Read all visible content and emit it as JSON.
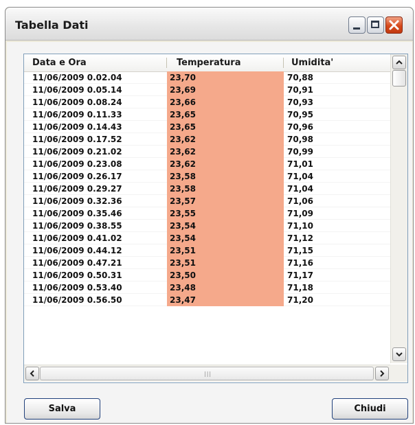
{
  "window": {
    "title": "Tabella Dati"
  },
  "table": {
    "columns": [
      "Data e Ora",
      "Temperatura",
      "Umidita'"
    ],
    "rows": [
      [
        "11/06/2009 0.02.04",
        "23,70",
        "70,88"
      ],
      [
        "11/06/2009 0.05.14",
        "23,69",
        "70,91"
      ],
      [
        "11/06/2009 0.08.24",
        "23,66",
        "70,93"
      ],
      [
        "11/06/2009 0.11.33",
        "23,65",
        "70,95"
      ],
      [
        "11/06/2009 0.14.43",
        "23,65",
        "70,96"
      ],
      [
        "11/06/2009 0.17.52",
        "23,62",
        "70,98"
      ],
      [
        "11/06/2009 0.21.02",
        "23,62",
        "70,99"
      ],
      [
        "11/06/2009 0.23.08",
        "23,62",
        "71,01"
      ],
      [
        "11/06/2009 0.26.17",
        "23,58",
        "71,04"
      ],
      [
        "11/06/2009 0.29.27",
        "23,58",
        "71,04"
      ],
      [
        "11/06/2009 0.32.36",
        "23,57",
        "71,06"
      ],
      [
        "11/06/2009 0.35.46",
        "23,55",
        "71,09"
      ],
      [
        "11/06/2009 0.38.55",
        "23,54",
        "71,10"
      ],
      [
        "11/06/2009 0.41.02",
        "23,54",
        "71,12"
      ],
      [
        "11/06/2009 0.44.12",
        "23,51",
        "71,15"
      ],
      [
        "11/06/2009 0.47.21",
        "23,51",
        "71,16"
      ],
      [
        "11/06/2009 0.50.31",
        "23,50",
        "71,17"
      ],
      [
        "11/06/2009 0.53.40",
        "23,48",
        "71,18"
      ],
      [
        "11/06/2009 0.56.50",
        "23,47",
        "71,20"
      ]
    ],
    "highlight_color": "#f5a98b"
  },
  "buttons": {
    "save": "Salva",
    "close": "Chiudi"
  },
  "icons": {
    "minimize": "minimize-icon",
    "maximize": "maximize-icon",
    "close": "close-icon",
    "scroll_up": "chevron-up-icon",
    "scroll_down": "chevron-down-icon",
    "scroll_left": "chevron-left-icon",
    "scroll_right": "chevron-right-icon"
  }
}
